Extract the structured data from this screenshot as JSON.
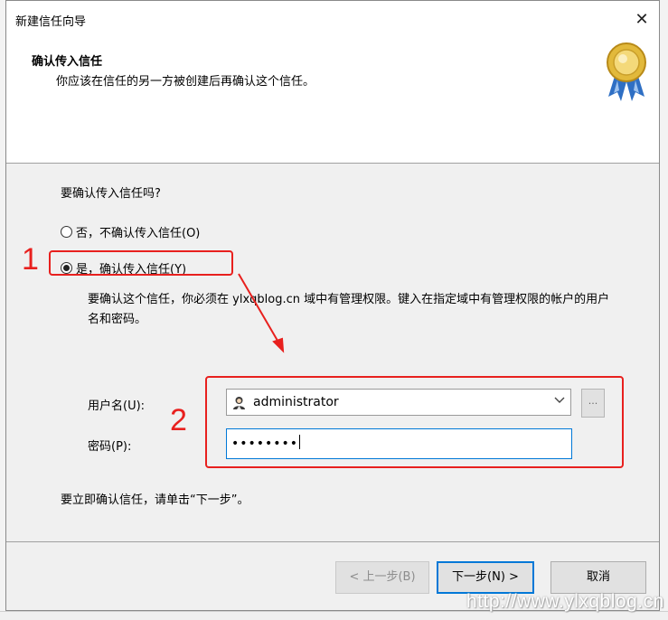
{
  "dialog": {
    "title": "新建信任向导",
    "close_glyph": "✕"
  },
  "header": {
    "title": "确认传入信任",
    "subtitle": "你应该在信任的另一方被创建后再确认这个信任。",
    "icon": "award-ribbon-icon"
  },
  "body": {
    "question": "要确认传入信任吗?",
    "options": [
      {
        "label": "否，不确认传入信任(O)",
        "selected": false
      },
      {
        "label": "是，确认传入信任(Y)",
        "selected": true
      }
    ],
    "description": "要确认这个信任，你必须在 ylxqblog.cn 域中有管理权限。键入在指定域中有管理权限的帐户的用户名和密码。",
    "username_label": "用户名(U):",
    "username_value": "administrator",
    "browse_label": "...",
    "password_label": "密码(P):",
    "password_value": "••••••••",
    "instruction": "要立即确认信任，请单击“下一步”。"
  },
  "buttons": {
    "back": "< 上一步(B)",
    "next": "下一步(N) >",
    "cancel": "取消"
  },
  "annotations": {
    "step1": "1",
    "step2": "2",
    "color": "#e8201e"
  },
  "watermark": "http://www.ylxqblog.cn"
}
